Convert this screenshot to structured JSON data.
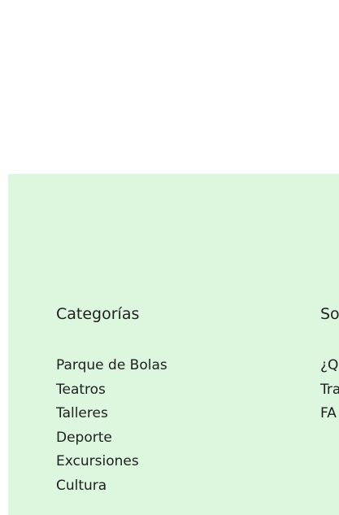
{
  "footer": {
    "categories": {
      "title": "Categorías",
      "items": [
        {
          "label": "Parque de Bolas"
        },
        {
          "label": "Teatros"
        },
        {
          "label": "Talleres"
        },
        {
          "label": "Deporte"
        },
        {
          "label": "Excursiones"
        },
        {
          "label": "Cultura"
        }
      ]
    },
    "about": {
      "title": "So",
      "items": [
        {
          "label": "¿Q"
        },
        {
          "label": "Tra"
        },
        {
          "label": "FA"
        }
      ]
    }
  },
  "colors": {
    "panel_background": "#dcf7de",
    "text": "#1f1f1f"
  }
}
